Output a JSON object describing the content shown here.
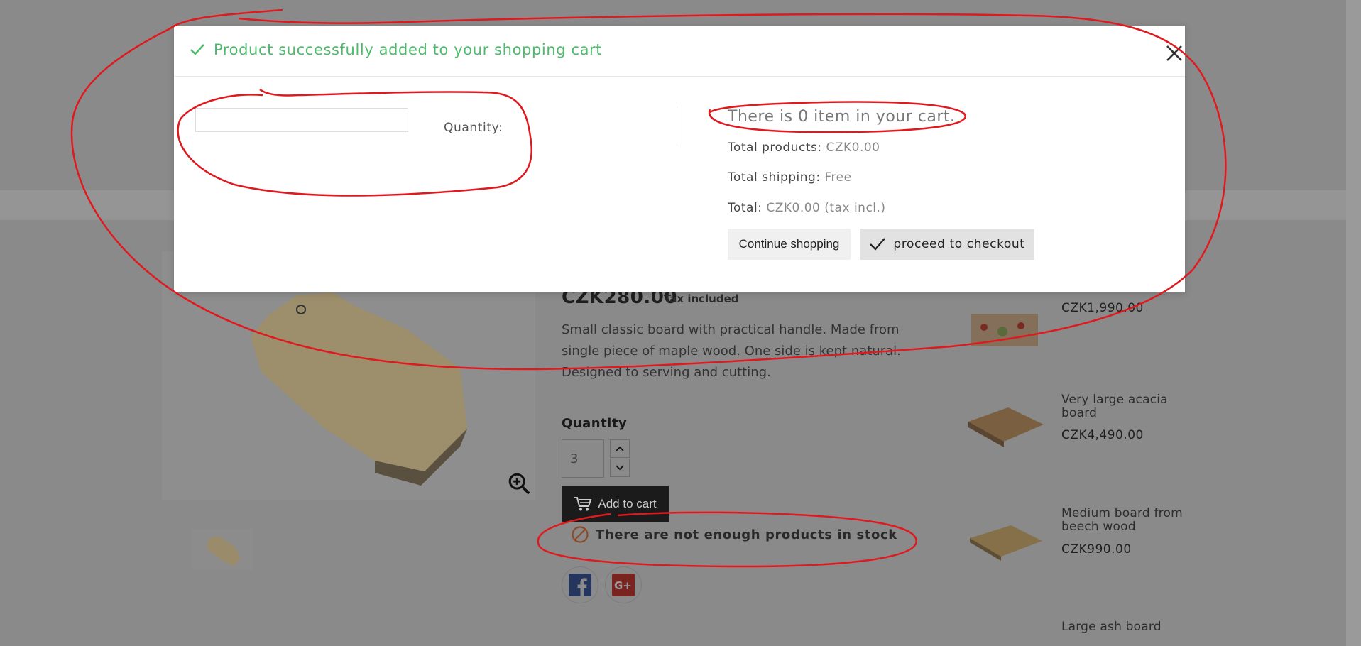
{
  "product": {
    "price": "CZK280.00",
    "tax_label": "Tax included",
    "description": "Small classic board with practical handle. Made from single piece of maple wood. One side is kept natural. Designed to serving and cutting.",
    "quantity_label": "Quantity",
    "quantity_value": "3",
    "add_to_cart": "Add to cart",
    "stock_message": "There are not enough products in stock"
  },
  "related_products": [
    {
      "name": "",
      "price": "CZK1,990.00"
    },
    {
      "name": "Very large acacia board",
      "price": "CZK4,490.00"
    },
    {
      "name": "Medium board from beech wood",
      "price": "CZK990.00"
    },
    {
      "name": "Large ash board",
      "price": ""
    }
  ],
  "modal": {
    "title": "Product successfully added to your shopping cart",
    "quantity_label": "Quantity:",
    "cart_summary": "There is 0 item in your cart.",
    "total_products_label": "Total products:",
    "total_products_value": "CZK0.00",
    "total_shipping_label": "Total shipping:",
    "total_shipping_value": "Free",
    "total_label": "Total:",
    "total_value": "CZK0.00 (tax incl.)",
    "continue_button": "Continue shopping",
    "checkout_button": "proceed to checkout"
  },
  "colors": {
    "success_green": "#4cbb6c",
    "annotation_red": "#e0191f",
    "overlay_gray": "#8a8a8a"
  },
  "icons": {
    "success": "check-icon",
    "close": "close-icon",
    "zoom": "zoom-in-icon",
    "cart": "shopping-cart-icon",
    "stock": "block-icon",
    "facebook": "facebook-icon",
    "google_plus": "google-plus-icon"
  }
}
